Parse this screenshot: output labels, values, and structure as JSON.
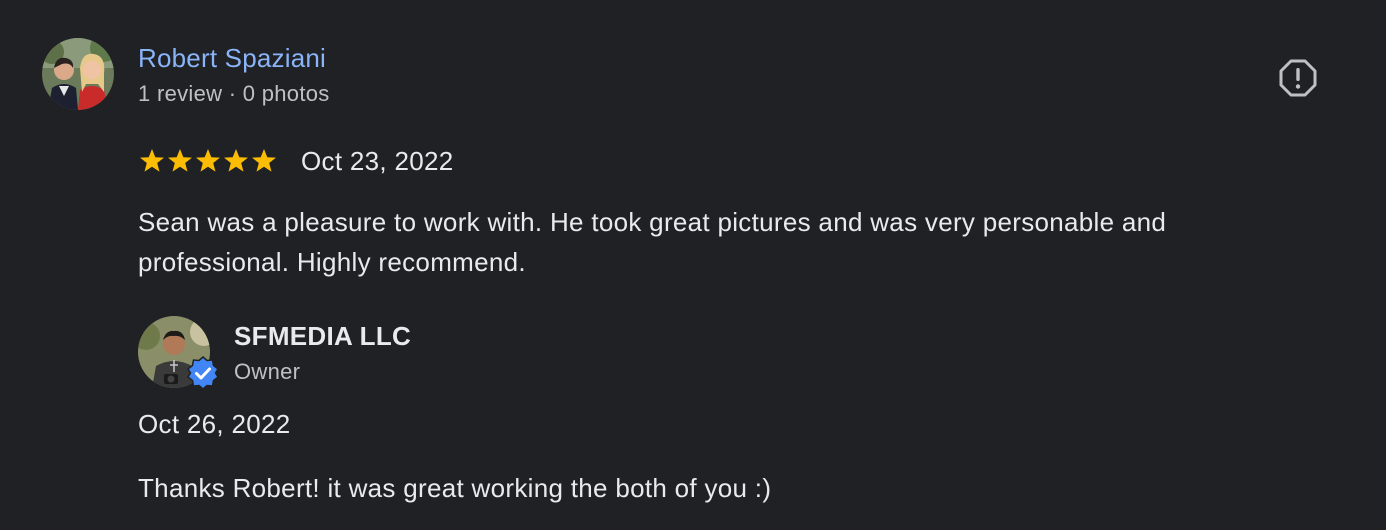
{
  "reviewer": {
    "name": "Robert Spaziani",
    "meta": "1 review · 0 photos",
    "avatar_icon": "reviewer-avatar-photo"
  },
  "review": {
    "rating": 5,
    "rating_max": 5,
    "date": "Oct 23, 2022",
    "text": "Sean was a pleasure to work with. He took great pictures and was very personable and professional. Highly recommend."
  },
  "report_icon": "report-flag-icon",
  "owner_response": {
    "name": "SFMEDIA LLC",
    "role": "Owner",
    "date": "Oct 26, 2022",
    "text": "Thanks Robert! it was great working the both of you :)",
    "avatar_icon": "owner-avatar-photo",
    "badge_icon": "verified-badge-icon"
  },
  "colors": {
    "background": "#202124",
    "name_link": "#8ab4f8",
    "star": "#fbbc04",
    "badge": "#4285f4",
    "text": "#e8eaed",
    "secondary_text": "#bdc1c6"
  }
}
